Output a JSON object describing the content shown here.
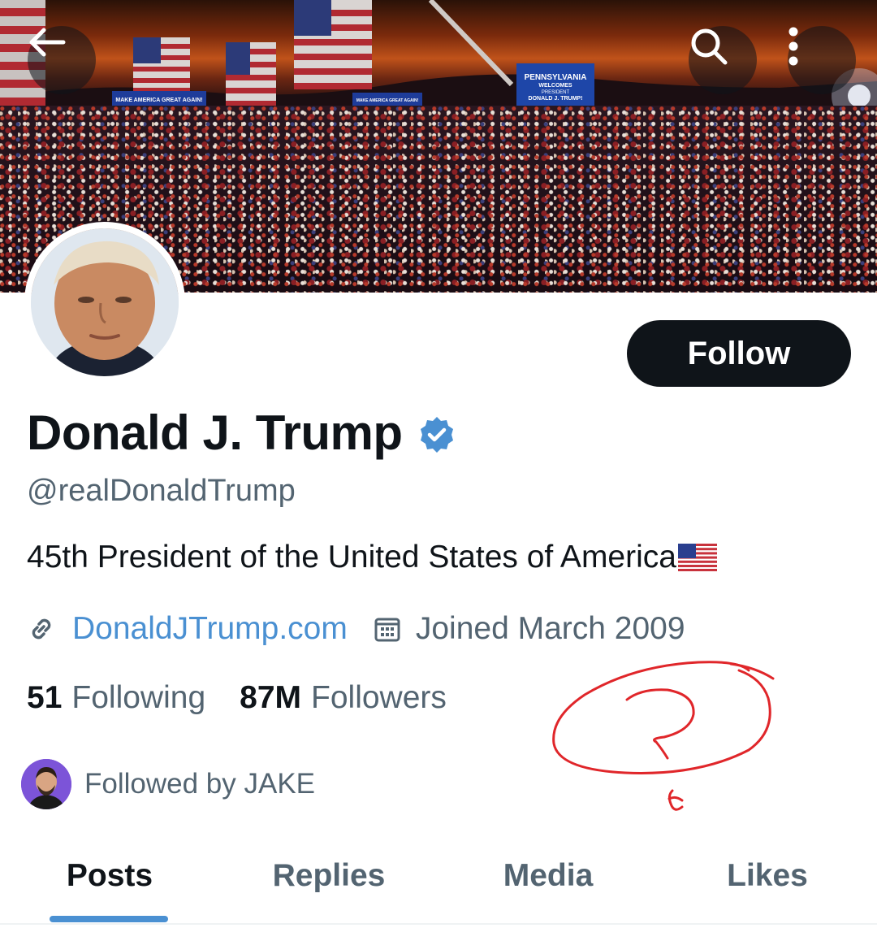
{
  "header": {
    "back_icon": "arrow-left-icon",
    "search_icon": "search-icon",
    "more_icon": "more-vertical-icon"
  },
  "banner": {
    "stage_sign": [
      "PENNSYLVANIA",
      "WELCOMES",
      "PRESIDENT",
      "DONALD J. TRUMP!"
    ],
    "banner_sign": "MAKE AMERICA GREAT AGAIN!"
  },
  "profile": {
    "follow_label": "Follow",
    "name": "Donald J. Trump",
    "verified_icon": "verified-badge-icon",
    "handle": "@realDonaldTrump",
    "bio": "45th President of the United States of America",
    "bio_emoji": "us-flag-emoji",
    "website": "DonaldJTrump.com",
    "joined": "Joined March 2009",
    "following_count": "51",
    "following_label": "Following",
    "followers_count": "87M",
    "followers_label": "Followers",
    "followed_by": "Followed by JAKE"
  },
  "tabs": [
    {
      "label": "Posts",
      "active": true
    },
    {
      "label": "Replies",
      "active": false
    },
    {
      "label": "Media",
      "active": false
    },
    {
      "label": "Likes",
      "active": false
    }
  ],
  "colors": {
    "accent": "#4a90d2",
    "text_primary": "#0f1419",
    "text_secondary": "#536471",
    "annotation": "#e0262a"
  }
}
